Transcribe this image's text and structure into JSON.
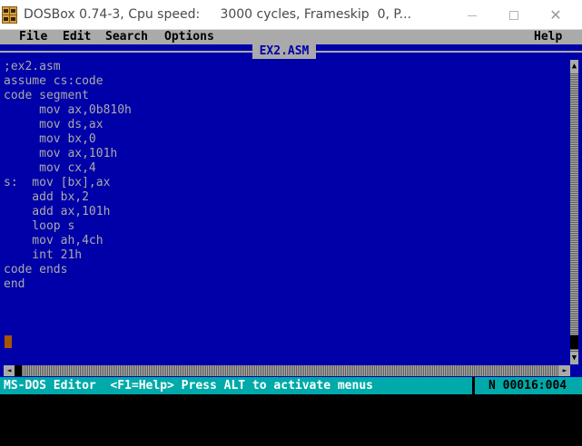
{
  "window": {
    "title": "DOSBox 0.74-3, Cpu speed:     3000 cycles, Frameskip  0, P...",
    "minimize_glyph": "",
    "close_glyph": "✕"
  },
  "menu": {
    "items": [
      {
        "label": "File"
      },
      {
        "label": "Edit"
      },
      {
        "label": "Search"
      },
      {
        "label": "Options"
      }
    ],
    "help": "Help"
  },
  "document": {
    "title": "EX2.ASM",
    "lines": [
      ";ex2.asm",
      "assume cs:code",
      "code segment",
      "     mov ax,0b810h",
      "     mov ds,ax",
      "     mov bx,0",
      "     mov ax,101h",
      "     mov cx,4",
      "s:  mov [bx],ax",
      "    add bx,2",
      "    add ax,101h",
      "    loop s",
      "    mov ah,4ch",
      "    int 21h",
      "code ends",
      "end"
    ]
  },
  "scrollbars": {
    "up_arrow": "▲",
    "down_arrow": "▼",
    "left_arrow": "◄",
    "right_arrow": "►"
  },
  "status": {
    "text": "MS-DOS Editor  <F1=Help> Press ALT to activate menus",
    "position": "N 00016:004"
  },
  "colors": {
    "dos_blue": "#0000a8",
    "dos_gray": "#aaaaaa",
    "status_cyan": "#00aaaa",
    "cursor_brown": "#a85400"
  }
}
